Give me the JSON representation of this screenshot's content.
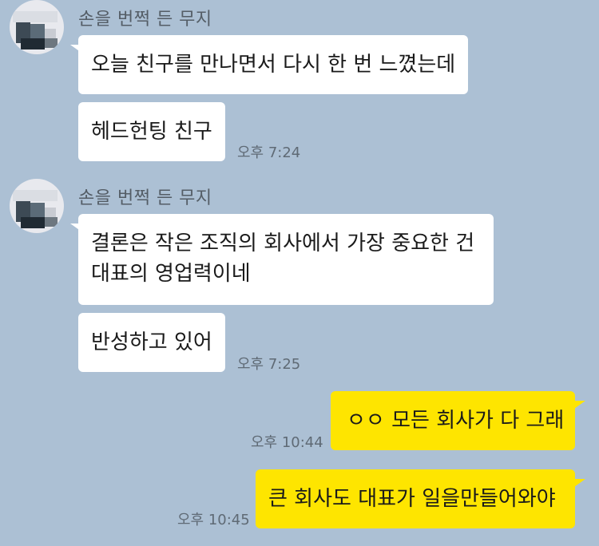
{
  "messages": {
    "group1": {
      "sender": "손을 번쩍 든 무지",
      "bubble1": "오늘 친구를 만나면서 다시 한 번 느꼈는데",
      "bubble2": "헤드헌팅 친구",
      "time": "오후 7:24"
    },
    "group2": {
      "sender": "손을 번쩍 든 무지",
      "bubble1_line1": "결론은 작은 조직의 회사에서 가장 중요한 건",
      "bubble1_line2": "대표의 영업력이네",
      "bubble2": "반성하고 있어",
      "time": "오후 7:25"
    },
    "mine1": {
      "text": "ㅇㅇ 모든 회사가 다 그래",
      "time": "오후 10:44"
    },
    "mine2": {
      "text": "큰 회사도 대표가 일을만들어와야",
      "time": "오후 10:45"
    }
  },
  "colors": {
    "background": "#acc0d4",
    "incoming_bubble": "#ffffff",
    "outgoing_bubble": "#fee500"
  },
  "icons": {
    "avatar": "profile-avatar"
  }
}
